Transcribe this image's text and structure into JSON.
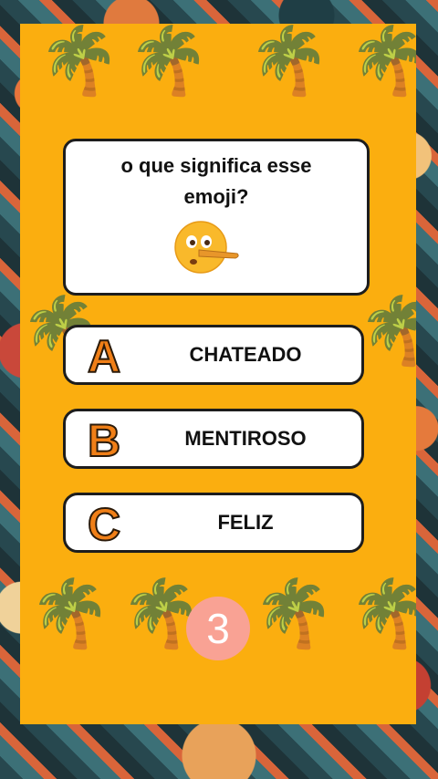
{
  "question": {
    "text": "o que significa esse emoji?",
    "emoji": "lying-face-emoji"
  },
  "answers": [
    {
      "letter": "A",
      "label": "CHATEADO"
    },
    {
      "letter": "B",
      "label": "MENTIROSO"
    },
    {
      "letter": "C",
      "label": "FELIZ"
    }
  ],
  "timer": {
    "value": "3"
  },
  "colors": {
    "card": "#fbae0f",
    "letter": "#f07f17",
    "timer": "#f9a294"
  }
}
